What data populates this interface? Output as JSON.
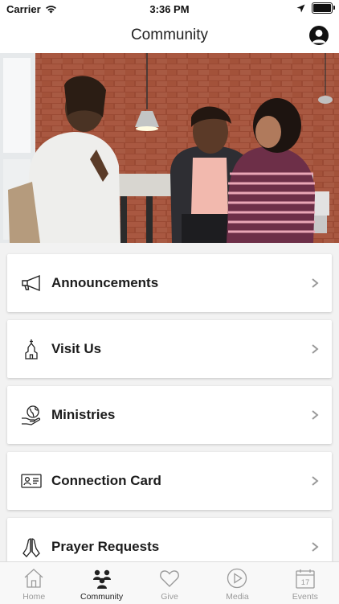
{
  "status_bar": {
    "carrier": "Carrier",
    "time": "3:36 PM"
  },
  "nav": {
    "title": "Community"
  },
  "menu": [
    {
      "label": "Announcements",
      "icon": "megaphone-icon"
    },
    {
      "label": "Visit Us",
      "icon": "church-icon"
    },
    {
      "label": "Ministries",
      "icon": "globe-hand-icon"
    },
    {
      "label": "Connection Card",
      "icon": "id-card-icon"
    },
    {
      "label": "Prayer Requests",
      "icon": "praying-hands-icon"
    }
  ],
  "tabs": [
    {
      "label": "Home",
      "icon": "home-icon",
      "active": false
    },
    {
      "label": "Community",
      "icon": "people-icon",
      "active": true
    },
    {
      "label": "Give",
      "icon": "heart-icon",
      "active": false
    },
    {
      "label": "Media",
      "icon": "play-icon",
      "active": false
    },
    {
      "label": "Events",
      "icon": "calendar-icon",
      "active": false
    }
  ],
  "events_icon_day": "17",
  "colors": {
    "active_tab": "#222222",
    "inactive_tab": "#9a9a9a",
    "background": "#f2f2f2"
  }
}
